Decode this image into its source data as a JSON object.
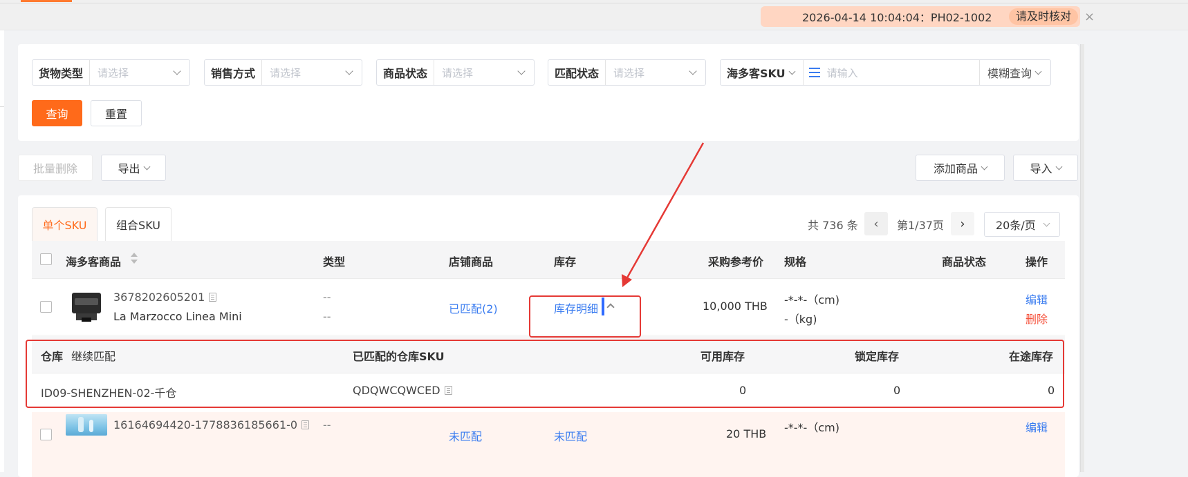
{
  "notice": {
    "text": "2026-04-14 10:04:04：PH02-1002",
    "pill": "请及时核对",
    "close": "×"
  },
  "filters": [
    {
      "label": "货物类型",
      "placeholder": "请选择"
    },
    {
      "label": "销售方式",
      "placeholder": "请选择"
    },
    {
      "label": "商品状态",
      "placeholder": "请选择"
    },
    {
      "label": "匹配状态",
      "placeholder": "请选择"
    }
  ],
  "sku_filter": {
    "label": "海多客SKU",
    "placeholder": "请输入",
    "mode": "模糊查询"
  },
  "buttons": {
    "query": "查询",
    "reset": "重置",
    "batch_delete": "批量删除",
    "export": "导出",
    "add_product": "添加商品",
    "import": "导入"
  },
  "tabs": [
    "单个SKU",
    "组合SKU"
  ],
  "pager": {
    "total": "共 736 条",
    "page": "第1/37页",
    "prev": "‹",
    "next": "›",
    "page_size": "20条/页"
  },
  "columns": [
    "海多客商品",
    "类型",
    "店铺商品",
    "库存",
    "采购参考价",
    "规格",
    "商品状态",
    "操作"
  ],
  "rows": [
    {
      "sku": "3678202605201",
      "name": "La Marzocco Linea Mini",
      "type_1": "--",
      "type_2": "--",
      "store": "已匹配(2)",
      "stock": "库存明细",
      "price": "10,000 THB",
      "spec_1": "-*-*-（cm)",
      "spec_2": "-（kg)",
      "edit": "编辑",
      "delete": "删除"
    },
    {
      "sku": "16164694420-1778836185661-0",
      "type_1": "--",
      "store": "未匹配",
      "stock": "未匹配",
      "price": "20 THB",
      "spec_1": "-*-*-（cm)",
      "edit": "编辑"
    }
  ],
  "sub_table": {
    "columns": {
      "warehouse": "仓库",
      "continue_match": "继续匹配",
      "matched_sku": "已匹配的仓库SKU",
      "available": "可用库存",
      "locked": "锁定库存",
      "in_transit": "在途库存"
    },
    "row": {
      "warehouse": "ID09-SHENZHEN-02-千仓",
      "matched_sku": "QDQWCQWCED",
      "available": "0",
      "locked": "0",
      "in_transit": "0"
    }
  },
  "colors": {
    "accent": "#ff6a1a",
    "link": "#3a7cf0",
    "annotation": "#e53935",
    "danger": "#f5533d"
  }
}
